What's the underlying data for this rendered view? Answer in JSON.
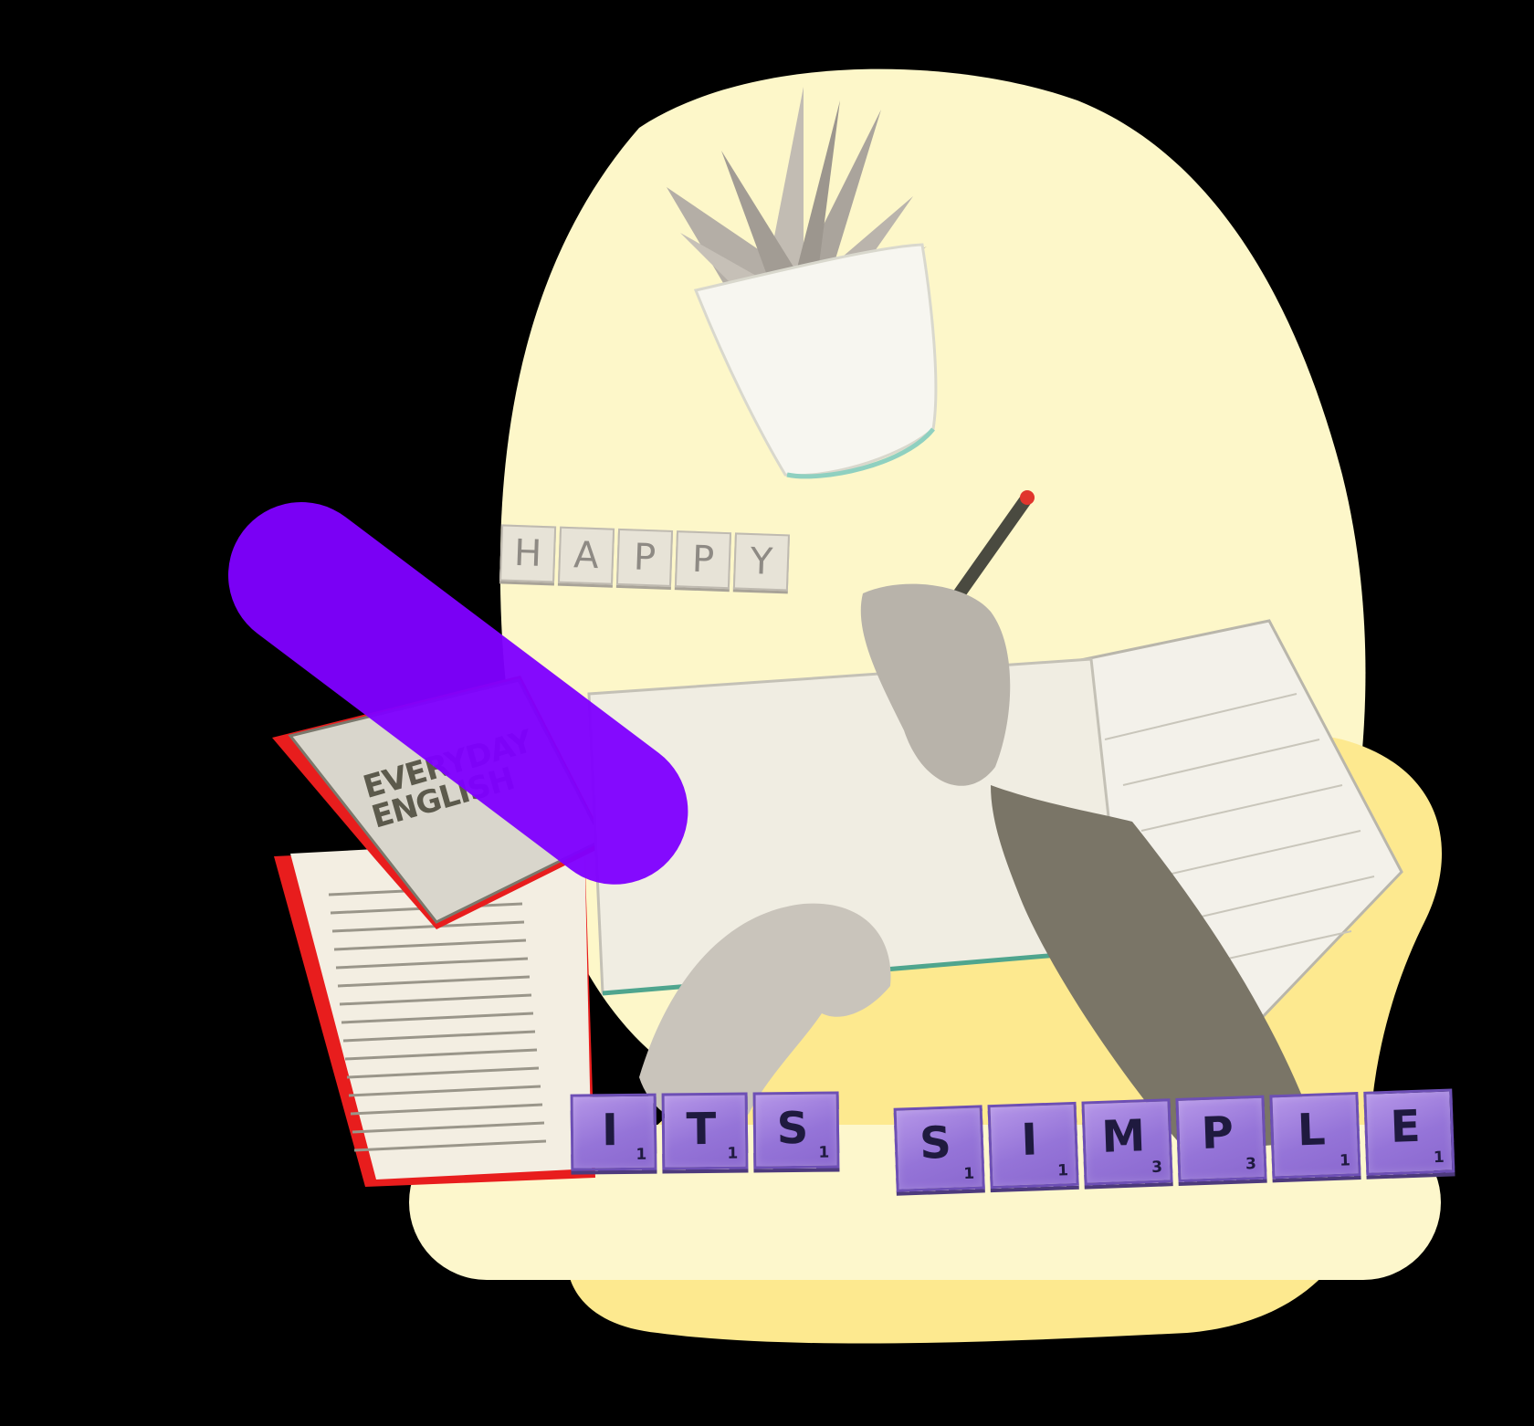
{
  "happy_tiles": [
    "H",
    "A",
    "P",
    "P",
    "Y"
  ],
  "book": {
    "title_line1": "EVERYDAY",
    "title_line2": "ENGLISH"
  },
  "tiles_its": [
    {
      "letter": "I",
      "score": "1"
    },
    {
      "letter": "T",
      "score": "1"
    },
    {
      "letter": "S",
      "score": "1"
    }
  ],
  "tiles_simple": [
    {
      "letter": "S",
      "score": "1"
    },
    {
      "letter": "I",
      "score": "1"
    },
    {
      "letter": "M",
      "score": "3"
    },
    {
      "letter": "P",
      "score": "3"
    },
    {
      "letter": "L",
      "score": "1"
    },
    {
      "letter": "E",
      "score": "1"
    }
  ],
  "colors": {
    "background": "#000000",
    "blob_light": "#fdf7c9",
    "blob_yellow": "#fde98f",
    "pill": "#7f00ff",
    "tile_purple": "#9574d8"
  }
}
